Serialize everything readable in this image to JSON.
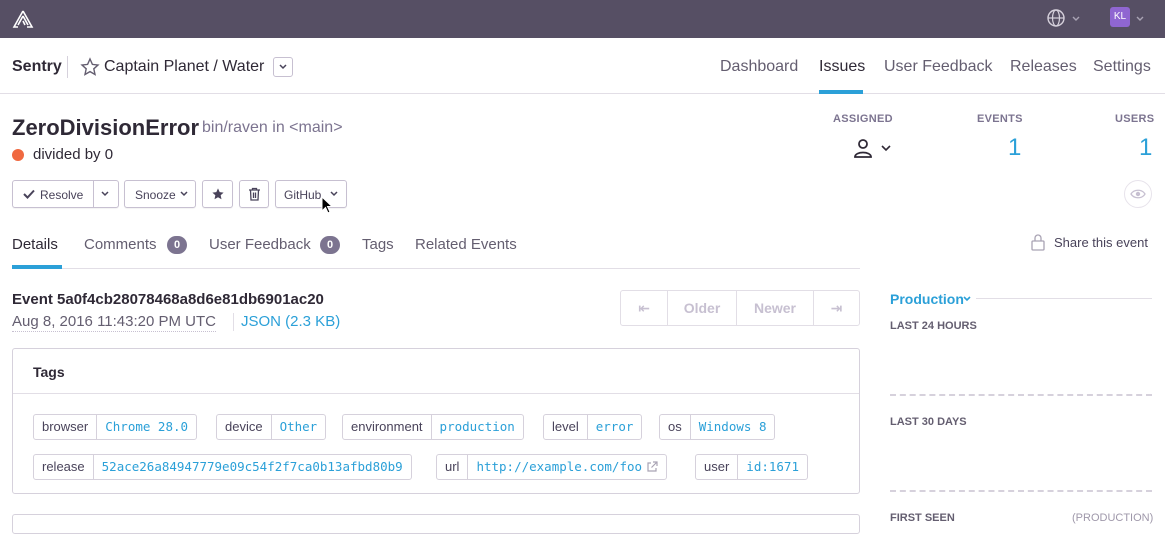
{
  "topbar": {
    "logo_icon": "sentry-logo-icon",
    "globe_icon": "globe-icon",
    "avatar_initials": "KL",
    "avatar_color": "#8f66d1"
  },
  "subnav": {
    "org": "Sentry",
    "project": "Captain Planet / Water",
    "nav": [
      "Dashboard",
      "Issues",
      "User Feedback",
      "Releases",
      "Settings"
    ],
    "active_nav": "Issues"
  },
  "issue": {
    "title": "ZeroDivisionError",
    "culprit": "bin/raven in <main>",
    "message": "divided by 0",
    "level_color": "#f06940"
  },
  "stats": {
    "assigned_label": "ASSIGNED",
    "events_label": "EVENTS",
    "events_value": "1",
    "users_label": "USERS",
    "users_value": "1"
  },
  "actions": {
    "resolve": "Resolve",
    "snooze": "Snooze",
    "github": "GitHub"
  },
  "tabs": {
    "details": "Details",
    "comments": "Comments",
    "comments_count": "0",
    "user_feedback": "User Feedback",
    "user_feedback_count": "0",
    "tags": "Tags",
    "related": "Related Events",
    "share": "Share this event"
  },
  "event": {
    "id": "Event 5a0f4cb28078468a8d6e81db6901ac20",
    "date": "Aug 8, 2016 11:43:20 PM UTC",
    "json": "JSON (2.3 KB)",
    "pager": {
      "first": "⇤",
      "older": "Older",
      "newer": "Newer",
      "last": "⇥"
    }
  },
  "tags_section": {
    "title": "Tags",
    "tags": [
      {
        "key": "browser",
        "value": "Chrome 28.0"
      },
      {
        "key": "device",
        "value": "Other"
      },
      {
        "key": "environment",
        "value": "production"
      },
      {
        "key": "level",
        "value": "error"
      },
      {
        "key": "os",
        "value": "Windows 8"
      },
      {
        "key": "release",
        "value": "52ace26a84947779e09c54f2f7ca0b13afbd80b9"
      },
      {
        "key": "url",
        "value": "http://example.com/foo"
      },
      {
        "key": "user",
        "value": "id:1671"
      }
    ]
  },
  "sidebar": {
    "environment": "Production",
    "last_24": "LAST 24 HOURS",
    "last_30": "LAST 30 DAYS",
    "first_seen": "FIRST SEEN",
    "first_seen_env": "(PRODUCTION)"
  },
  "colors": {
    "accent": "#2ba0d8",
    "header": "#564f64"
  }
}
